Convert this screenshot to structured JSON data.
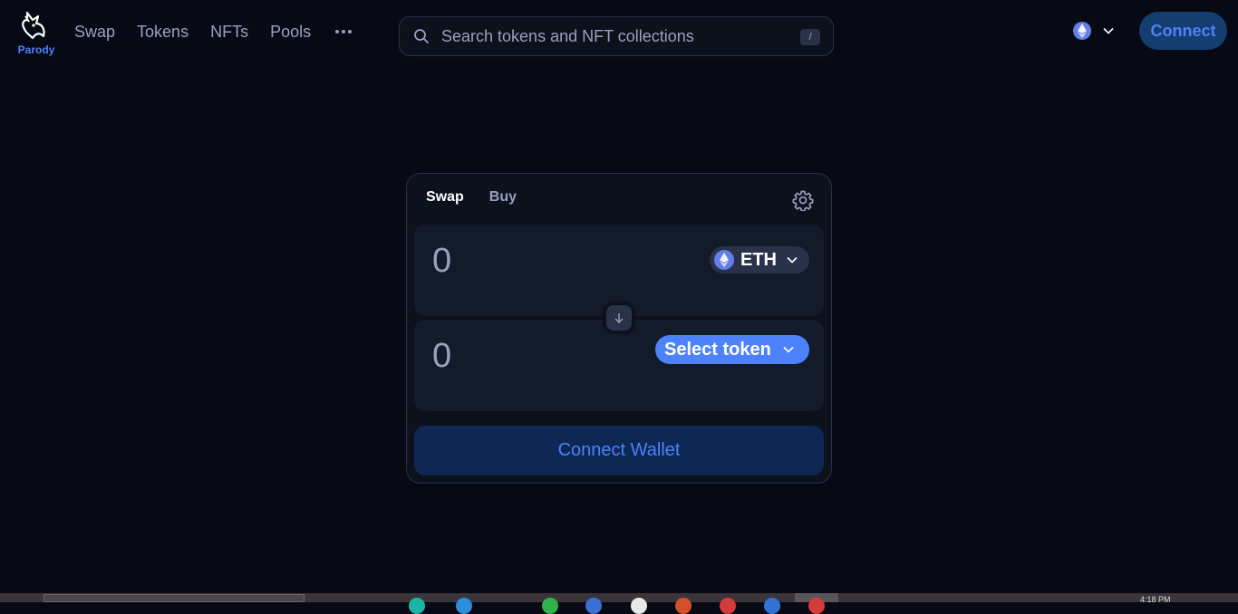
{
  "header": {
    "logo_text": "Parody",
    "nav": [
      "Swap",
      "Tokens",
      "NFTs",
      "Pools"
    ],
    "more_icon": "ellipsis-icon",
    "search_placeholder": "Search tokens and NFT collections",
    "search_shortcut": "/",
    "network_icon": "ethereum-icon",
    "connect_label": "Connect"
  },
  "swap": {
    "tabs": [
      "Swap",
      "Buy"
    ],
    "settings_icon": "gear-icon",
    "input_amount": "0",
    "input_token": "ETH",
    "switch_icon": "arrow-down-icon",
    "output_amount": "0",
    "select_token_label": "Select token",
    "connect_wallet_label": "Connect Wallet"
  },
  "taskbar": {
    "clock": "4:18 PM"
  },
  "colors": {
    "background": "#070914",
    "accent": "#4c82fb",
    "panel": "#131a2a",
    "muted_text": "#98a1c0"
  }
}
